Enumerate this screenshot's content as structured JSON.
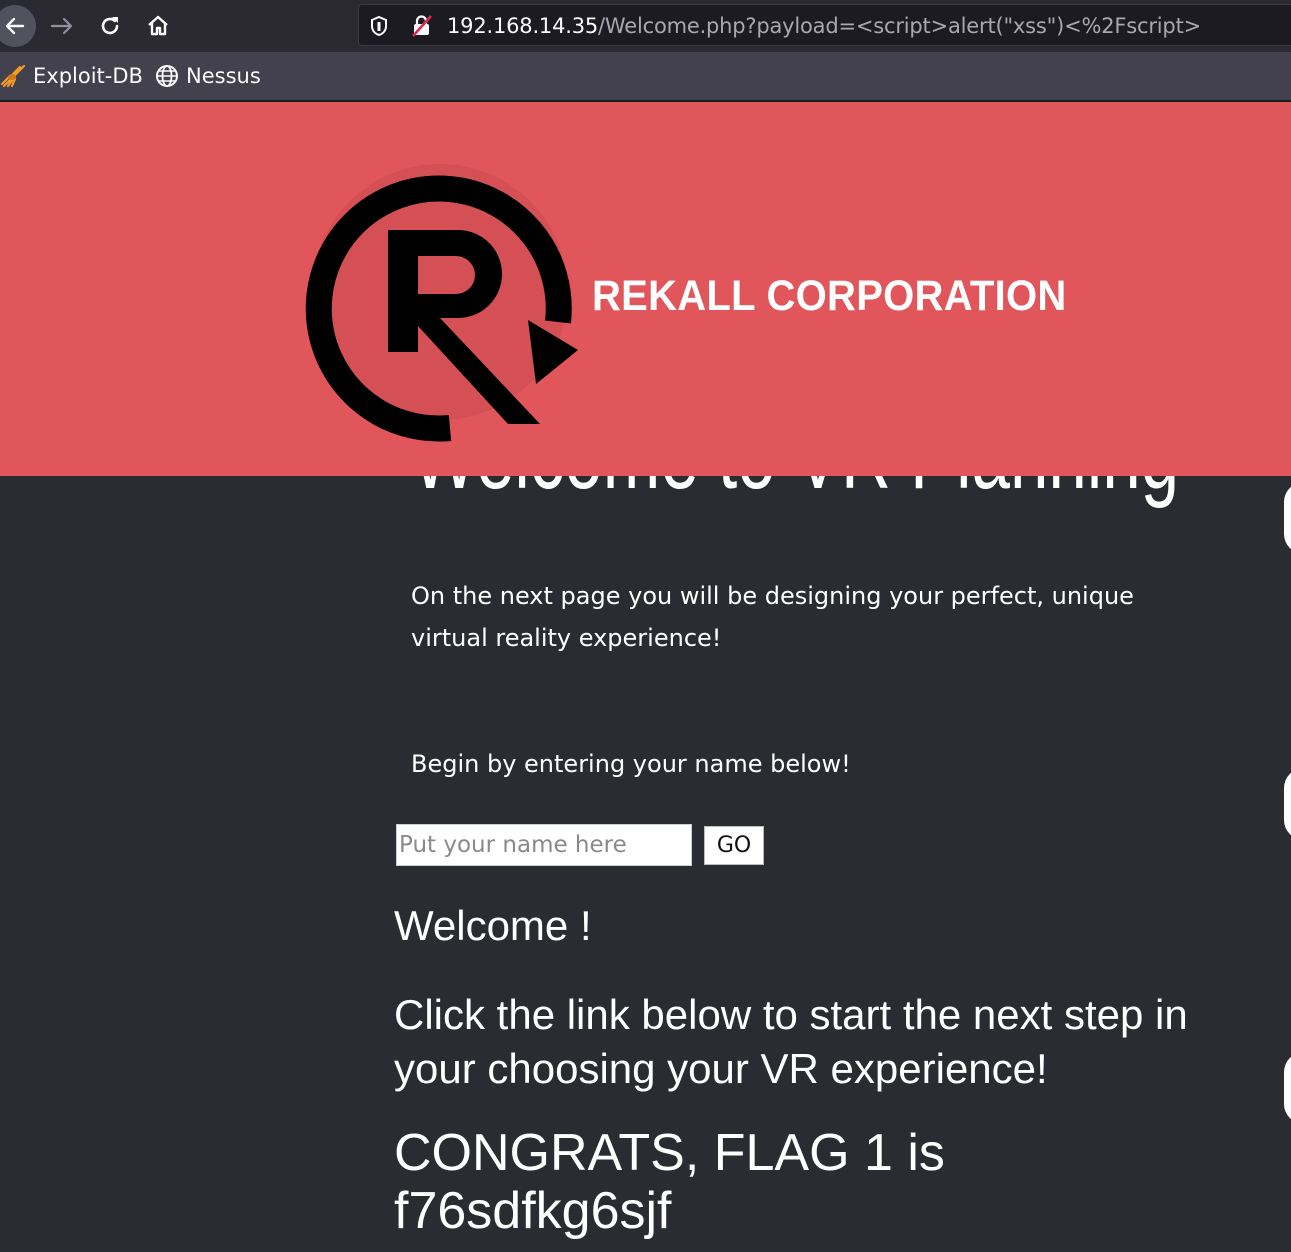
{
  "browser": {
    "url_host": "192.168.14.35",
    "url_path": "/Welcome.php?payload=<script>alert(\"xss\")<%2Fscript>",
    "bookmarks": [
      {
        "label": "Exploit-DB",
        "icon": "spider-icon"
      },
      {
        "label": "Nessus",
        "icon": "globe-icon"
      }
    ]
  },
  "header": {
    "brand": "REKALL CORPORATION",
    "color": "#e0565b"
  },
  "main": {
    "heading": "Welcome to VR Planning",
    "intro": "On the next  page you will be designing your perfect, unique virtual reality experience!",
    "prompt": "Begin by entering your name below!",
    "name_placeholder": "Put your name here",
    "go_label": "GO",
    "welcome": "Welcome !",
    "cta": "Click the link below to start the next step in your choosing your VR experience!",
    "flag": "CONGRATS, FLAG 1 is f76sdfkg6sjf"
  }
}
